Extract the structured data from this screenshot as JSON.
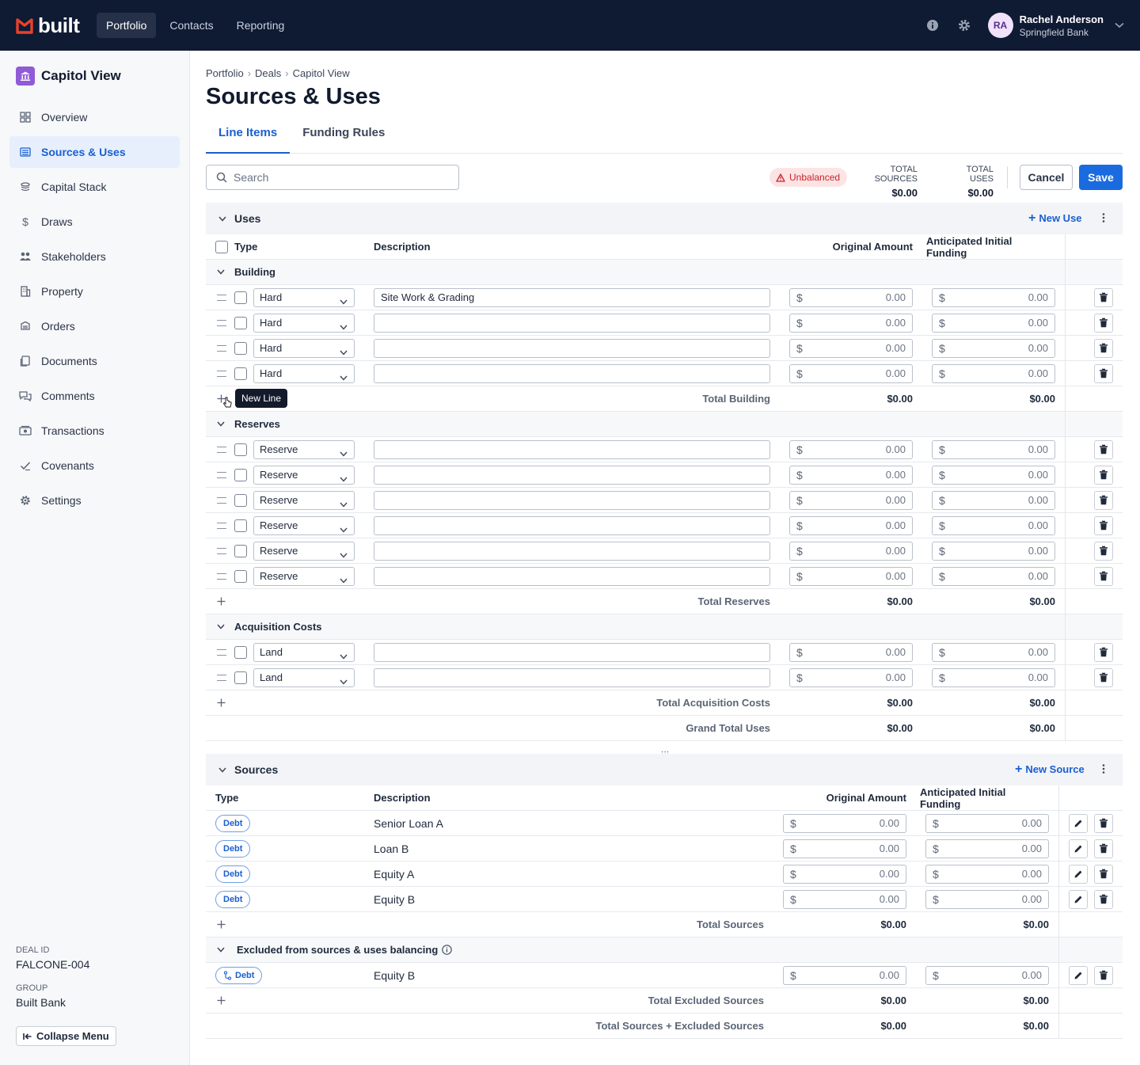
{
  "app": {
    "logo_text": "built",
    "brand_color": "#e8412c"
  },
  "topnav": {
    "items": [
      "Portfolio",
      "Contacts",
      "Reporting"
    ],
    "active": "Portfolio"
  },
  "user": {
    "initials": "RA",
    "name": "Rachel Anderson",
    "org": "Springfield Bank"
  },
  "sidebar": {
    "deal_name": "Capitol View",
    "items": [
      {
        "label": "Overview",
        "icon": "grid-icon"
      },
      {
        "label": "Sources & Uses",
        "icon": "list-icon"
      },
      {
        "label": "Capital Stack",
        "icon": "stack-icon"
      },
      {
        "label": "Draws",
        "icon": "dollar-icon"
      },
      {
        "label": "Stakeholders",
        "icon": "people-icon"
      },
      {
        "label": "Property",
        "icon": "building-icon"
      },
      {
        "label": "Orders",
        "icon": "orders-icon"
      },
      {
        "label": "Documents",
        "icon": "documents-icon"
      },
      {
        "label": "Comments",
        "icon": "comments-icon"
      },
      {
        "label": "Transactions",
        "icon": "transactions-icon"
      },
      {
        "label": "Covenants",
        "icon": "check-icon"
      },
      {
        "label": "Settings",
        "icon": "gear-icon"
      }
    ],
    "active": "Sources & Uses",
    "deal_id_label": "DEAL ID",
    "deal_id": "FALCONE-004",
    "group_label": "GROUP",
    "group": "Built Bank",
    "collapse_label": "Collapse Menu"
  },
  "breadcrumb": [
    "Portfolio",
    "Deals",
    "Capitol View"
  ],
  "page_title": "Sources & Uses",
  "tabs": [
    "Line Items",
    "Funding Rules"
  ],
  "toolbar": {
    "search_placeholder": "Search",
    "status": "Unbalanced",
    "total_sources_label": "TOTAL SOURCES",
    "total_sources": "$0.00",
    "total_uses_label": "TOTAL USES",
    "total_uses": "$0.00",
    "cancel": "Cancel",
    "save": "Save"
  },
  "uses": {
    "title": "Uses",
    "new_label": "New Use",
    "columns": {
      "type": "Type",
      "description": "Description",
      "original": "Original Amount",
      "anticipated": "Anticipated Initial Funding"
    },
    "currency": "$",
    "groups": [
      {
        "name": "Building",
        "rows": [
          {
            "type": "Hard",
            "description": "Site Work & Grading",
            "original": "0.00",
            "anticipated": "0.00"
          },
          {
            "type": "Hard",
            "description": "",
            "original": "0.00",
            "anticipated": "0.00"
          },
          {
            "type": "Hard",
            "description": "",
            "original": "0.00",
            "anticipated": "0.00"
          },
          {
            "type": "Hard",
            "description": "",
            "original": "0.00",
            "anticipated": "0.00"
          }
        ],
        "total_label": "Total Building",
        "total_original": "$0.00",
        "total_anticipated": "$0.00"
      },
      {
        "name": "Reserves",
        "rows": [
          {
            "type": "Reserve",
            "description": "",
            "original": "0.00",
            "anticipated": "0.00"
          },
          {
            "type": "Reserve",
            "description": "",
            "original": "0.00",
            "anticipated": "0.00"
          },
          {
            "type": "Reserve",
            "description": "",
            "original": "0.00",
            "anticipated": "0.00"
          },
          {
            "type": "Reserve",
            "description": "",
            "original": "0.00",
            "anticipated": "0.00"
          },
          {
            "type": "Reserve",
            "description": "",
            "original": "0.00",
            "anticipated": "0.00"
          },
          {
            "type": "Reserve",
            "description": "",
            "original": "0.00",
            "anticipated": "0.00"
          }
        ],
        "total_label": "Total Reserves",
        "total_original": "$0.00",
        "total_anticipated": "$0.00"
      },
      {
        "name": "Acquisition Costs",
        "rows": [
          {
            "type": "Land",
            "description": "",
            "original": "0.00",
            "anticipated": "0.00"
          },
          {
            "type": "Land",
            "description": "",
            "original": "0.00",
            "anticipated": "0.00"
          }
        ],
        "total_label": "Total Acquisition Costs",
        "total_original": "$0.00",
        "total_anticipated": "$0.00"
      }
    ],
    "grand_total_label": "Grand Total Uses",
    "grand_total_original": "$0.00",
    "grand_total_anticipated": "$0.00",
    "tooltip": "New Line"
  },
  "sources": {
    "title": "Sources",
    "new_label": "New Source",
    "columns": {
      "type": "Type",
      "description": "Description",
      "original": "Original Amount",
      "anticipated": "Anticipated Initial Funding"
    },
    "currency": "$",
    "rows": [
      {
        "type": "Debt",
        "description": "Senior Loan A",
        "original": "0.00",
        "anticipated": "0.00"
      },
      {
        "type": "Debt",
        "description": "Loan B",
        "original": "0.00",
        "anticipated": "0.00"
      },
      {
        "type": "Debt",
        "description": "Equity A",
        "original": "0.00",
        "anticipated": "0.00"
      },
      {
        "type": "Debt",
        "description": "Equity B",
        "original": "0.00",
        "anticipated": "0.00"
      }
    ],
    "total_label": "Total Sources",
    "total_original": "$0.00",
    "total_anticipated": "$0.00",
    "excluded_title": "Excluded from sources & uses balancing",
    "excluded_rows": [
      {
        "type": "Debt",
        "description": "Equity B",
        "original": "0.00",
        "anticipated": "0.00"
      }
    ],
    "excluded_total_label": "Total Excluded Sources",
    "excluded_total_original": "$0.00",
    "excluded_total_anticipated": "$0.00",
    "combined_total_label": "Total Sources + Excluded Sources",
    "combined_total_original": "$0.00",
    "combined_total_anticipated": "$0.00"
  }
}
